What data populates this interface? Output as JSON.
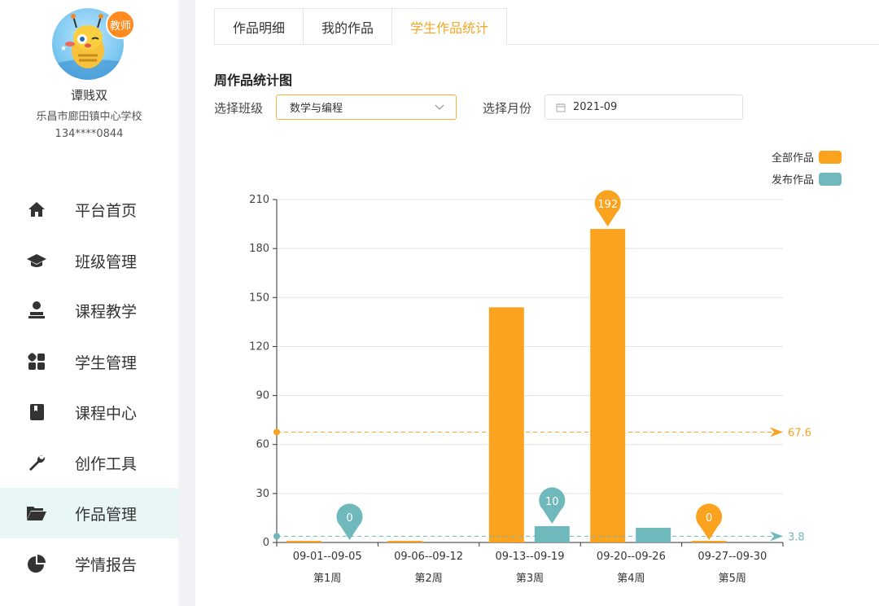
{
  "user": {
    "badge": "教师",
    "name": "谭贱双",
    "school": "乐昌市廊田镇中心学校",
    "phone": "134****0844"
  },
  "nav": [
    {
      "label": "平台首页",
      "icon": "home-icon"
    },
    {
      "label": "班级管理",
      "icon": "graduation-cap-icon"
    },
    {
      "label": "课程教学",
      "icon": "teacher-icon"
    },
    {
      "label": "学生管理",
      "icon": "grid-icon"
    },
    {
      "label": "课程中心",
      "icon": "book-icon"
    },
    {
      "label": "创作工具",
      "icon": "wrench-icon"
    },
    {
      "label": "作品管理",
      "icon": "folder-open-icon",
      "active": true
    },
    {
      "label": "学情报告",
      "icon": "pie-chart-icon"
    }
  ],
  "tabs": [
    {
      "label": "作品明细"
    },
    {
      "label": "我的作品"
    },
    {
      "label": "学生作品统计",
      "active": true
    }
  ],
  "section_title": "周作品统计图",
  "filters": {
    "class_label": "选择班级",
    "class_value": "数学与编程",
    "month_label": "选择月份",
    "month_value": "2021-09"
  },
  "colors": {
    "accent": "#f5a623",
    "all": "#fba21f",
    "published": "#6fb8bb"
  },
  "chart_data": {
    "type": "bar",
    "categories": [
      "09-01--09-05",
      "09-06--09-12",
      "09-13--09-19",
      "09-20--09-26",
      "09-27--09-30"
    ],
    "sub_categories": [
      "第1周",
      "第2周",
      "第3周",
      "第4周",
      "第5周"
    ],
    "series": [
      {
        "name": "全部作品",
        "values": [
          0,
          0,
          144,
          192,
          0
        ]
      },
      {
        "name": "发布作品",
        "values": [
          0,
          0,
          10,
          9,
          0
        ]
      }
    ],
    "ylim": [
      0,
      210
    ],
    "yticks": [
      0,
      30,
      60,
      90,
      120,
      150,
      180,
      210
    ],
    "mark_lines": [
      {
        "series": "全部作品",
        "value": 67.6,
        "label": "67.6"
      },
      {
        "series": "发布作品",
        "value": 3.8,
        "label": "3.8"
      }
    ],
    "mark_points": [
      {
        "series": "全部作品",
        "category": "09-20--09-26",
        "value": 192,
        "label": "192"
      },
      {
        "series": "全部作品",
        "category": "09-27--09-30",
        "value": 0,
        "label": "0"
      },
      {
        "series": "发布作品",
        "category": "09-13--09-19",
        "value": 10,
        "label": "10"
      },
      {
        "series": "发布作品",
        "category": "09-01--09-05",
        "value": 0,
        "label": "0"
      }
    ],
    "legend_position": "top-right",
    "grid": true
  }
}
